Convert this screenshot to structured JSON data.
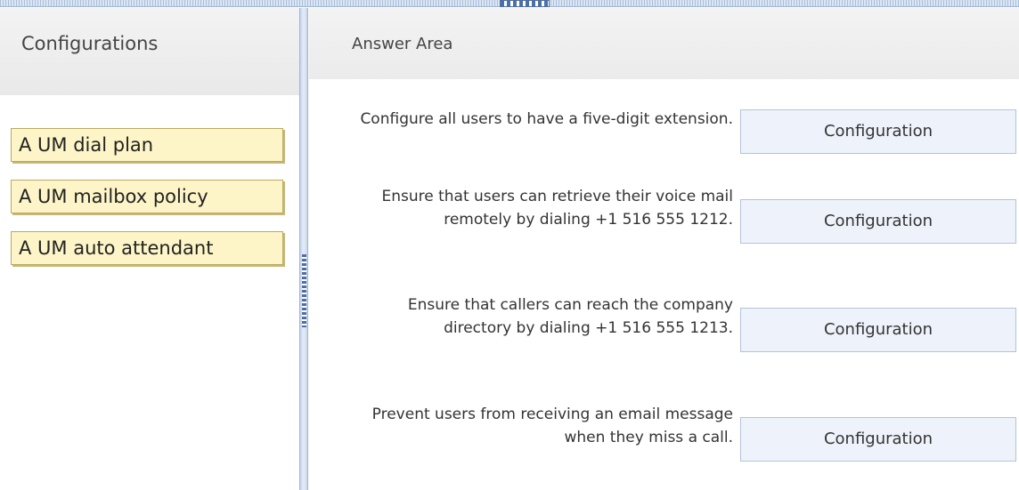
{
  "left": {
    "title": "Configurations",
    "items": [
      {
        "label": "A UM dial plan"
      },
      {
        "label": "A UM mailbox policy"
      },
      {
        "label": "A UM auto attendant"
      }
    ]
  },
  "right": {
    "title": "Answer Area",
    "rows": [
      {
        "requirement": "Configure all users to have a five-digit extension.",
        "target": "Configuration"
      },
      {
        "requirement": "Ensure that users can retrieve their voice mail remotely by dialing +1 516 555 1212.",
        "target": "Configuration"
      },
      {
        "requirement": "Ensure that callers can reach the company directory by dialing +1 516 555 1213.",
        "target": "Configuration"
      },
      {
        "requirement": "Prevent users from receiving an email message when they miss a call.",
        "target": "Configuration"
      }
    ]
  }
}
